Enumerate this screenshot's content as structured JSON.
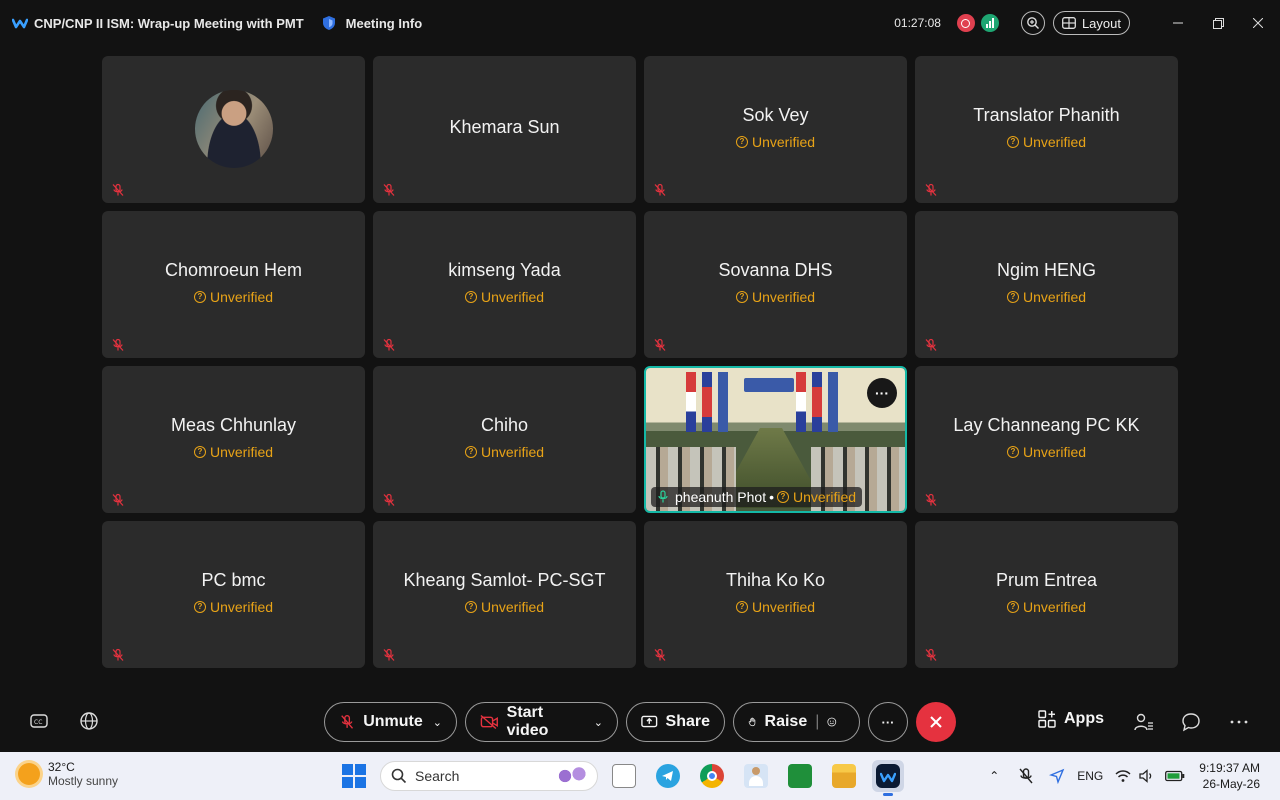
{
  "window": {
    "title": "CNP/CNP II ISM: Wrap-up Meeting with PMT",
    "meeting_info": "Meeting Info",
    "timer": "01:27:08",
    "layout_label": "Layout"
  },
  "participants": [
    {
      "name": "",
      "has_avatar": true,
      "unverified": ""
    },
    {
      "name": "Khemara Sun",
      "unverified": ""
    },
    {
      "name": "Sok Vey",
      "unverified": "Unverified"
    },
    {
      "name": "Translator Phanith",
      "unverified": "Unverified"
    },
    {
      "name": "Chomroeun Hem",
      "unverified": "Unverified"
    },
    {
      "name": "kimseng Yada",
      "unverified": "Unverified"
    },
    {
      "name": "Sovanna DHS",
      "unverified": "Unverified"
    },
    {
      "name": "Ngim HENG",
      "unverified": "Unverified"
    },
    {
      "name": "Meas Chhunlay",
      "unverified": "Unverified"
    },
    {
      "name": "Chiho",
      "unverified": "Unverified"
    },
    {
      "name": "pheanuth Phot",
      "video": true,
      "unverified": "Unverified",
      "separator": "•"
    },
    {
      "name": "Lay Channeang PC KK",
      "unverified": "Unverified"
    },
    {
      "name": "PC bmc",
      "unverified": "Unverified"
    },
    {
      "name": "Kheang Samlot- PC-SGT",
      "unverified": "Unverified"
    },
    {
      "name": "Thiha Ko Ko",
      "unverified": "Unverified"
    },
    {
      "name": "Prum Entrea",
      "unverified": "Unverified"
    }
  ],
  "controls": {
    "unmute": "Unmute",
    "start_video": "Start video",
    "share": "Share",
    "raise": "Raise",
    "more": "···",
    "apps": "Apps"
  },
  "taskbar": {
    "temp": "32°C",
    "condition": "Mostly sunny",
    "search_placeholder": "Search",
    "language": "ENG",
    "time": "9:19:37 AM",
    "date": "26-May-26"
  },
  "colors": {
    "accent_unverified": "#e8a317",
    "end_call": "#e5323f",
    "active_speaker_border": "#14b8a6",
    "tile_bg": "#2b2b2b"
  }
}
